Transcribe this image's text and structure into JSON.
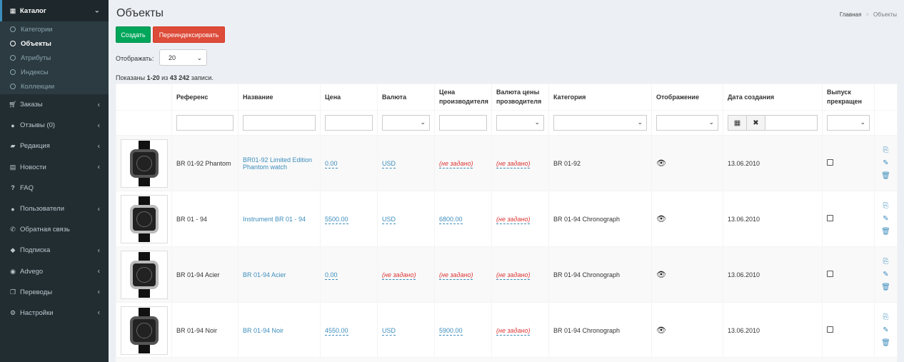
{
  "sidebar": {
    "catalog": {
      "icon": "table-icon",
      "label": "Каталог"
    },
    "submenu": [
      {
        "label": "Категории",
        "active": false
      },
      {
        "label": "Объекты",
        "active": true
      },
      {
        "label": "Атрибуты",
        "active": false
      },
      {
        "label": "Индексы",
        "active": false
      },
      {
        "label": "Коллекции",
        "active": false
      }
    ],
    "items": [
      {
        "icon": "cart-icon",
        "label": "Заказы",
        "has_chevron": true
      },
      {
        "icon": "comments-icon",
        "label": "Отзывы (0)",
        "has_chevron": true
      },
      {
        "icon": "book-icon",
        "label": "Редакция",
        "has_chevron": true
      },
      {
        "icon": "newspaper-icon",
        "label": "Новости",
        "has_chevron": true
      },
      {
        "icon": "question-icon",
        "label": "FAQ",
        "has_chevron": false
      },
      {
        "icon": "user-icon",
        "label": "Пользователи",
        "has_chevron": true
      },
      {
        "icon": "phone-icon",
        "label": "Обратная связь",
        "has_chevron": false
      },
      {
        "icon": "tags-icon",
        "label": "Подписка",
        "has_chevron": true
      },
      {
        "icon": "globe-icon",
        "label": "Advego",
        "has_chevron": true
      },
      {
        "icon": "copy-icon",
        "label": "Переводы",
        "has_chevron": true
      },
      {
        "icon": "gear-icon",
        "label": "Настройки",
        "has_chevron": true
      }
    ]
  },
  "page": {
    "title": "Объекты",
    "breadcrumb": {
      "home": "Главная",
      "current": "Объекты"
    }
  },
  "toolbar": {
    "create_label": "Создать",
    "reindex_label": "Переиндексировать"
  },
  "pager": {
    "show_label": "Отображать:",
    "page_size": "20"
  },
  "summary": {
    "prefix": "Показаны ",
    "range": "1-20",
    "mid": " из ",
    "total": "43 242",
    "suffix": " записи."
  },
  "table": {
    "headers": [
      "",
      "Референс",
      "Название",
      "Цена",
      "Валюта",
      "Цена производителя",
      "Валюта цены прозводителя",
      "Категория",
      "Отображение",
      "Дата создания",
      "Выпуск прекращен",
      ""
    ],
    "rows": [
      {
        "ref": "BR 01-92 Phantom",
        "name": "BR01-92 Limited Edition Phantom watch",
        "price": "0.00",
        "currency": "USD",
        "mprice": "(не задано)",
        "mcurrency": "(не задано)",
        "category": "BR 01-92",
        "date": "13.06.2010",
        "watch_style": "black"
      },
      {
        "ref": "BR 01 - 94",
        "name": "Instrument BR 01 - 94",
        "price": "5500.00",
        "currency": "USD",
        "mprice": "6800.00",
        "mcurrency": "(не задано)",
        "category": "BR 01-94 Chronograph",
        "date": "13.06.2010",
        "watch_style": "steel"
      },
      {
        "ref": "BR 01-94 Acier",
        "name": "BR 01-94 Acier",
        "price": "0.00",
        "currency": "(не задано)",
        "mprice": "(не задано)",
        "mcurrency": "(не задано)",
        "category": "BR 01-94 Chronograph",
        "date": "13.06.2010",
        "watch_style": "steel"
      },
      {
        "ref": "BR 01-94 Noir",
        "name": "BR 01-94 Noir",
        "price": "4550.00",
        "currency": "USD",
        "mprice": "5900.00",
        "mcurrency": "(не задано)",
        "category": "BR 01-94 Chronograph",
        "date": "13.06.2010",
        "watch_style": "black"
      }
    ]
  },
  "colors": {
    "success": "#00a65a",
    "danger": "#dd4b39",
    "link": "#3c8dbc",
    "sidebar": "#222d32"
  }
}
